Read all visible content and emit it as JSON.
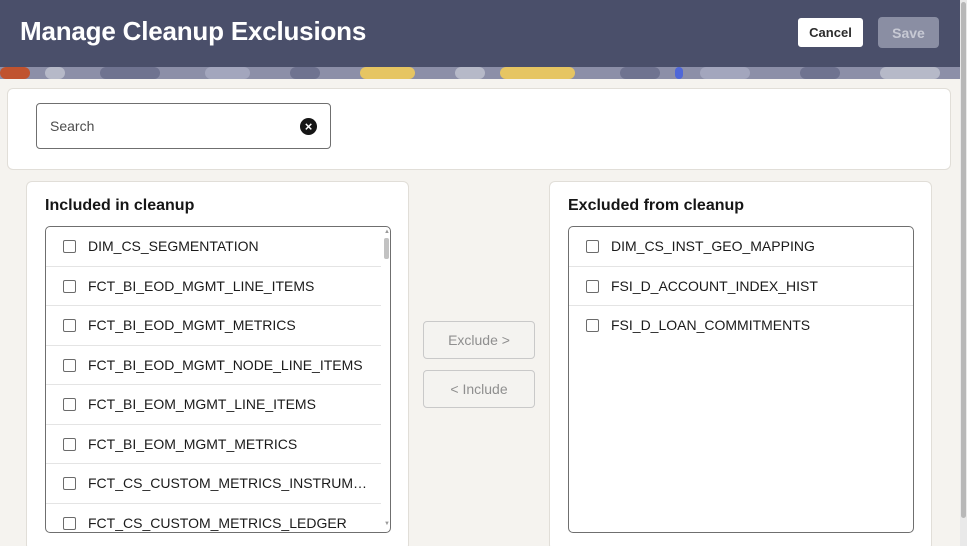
{
  "header": {
    "title": "Manage Cleanup Exclusions",
    "cancel_label": "Cancel",
    "save_label": "Save",
    "background": "#4a4f6a"
  },
  "search": {
    "placeholder": "Search",
    "value": "",
    "clear_icon": "clear-circle-icon"
  },
  "included": {
    "heading": "Included in cleanup",
    "items": [
      {
        "label": "DIM_CS_SEGMENTATION",
        "checked": false
      },
      {
        "label": "FCT_BI_EOD_MGMT_LINE_ITEMS",
        "checked": false
      },
      {
        "label": "FCT_BI_EOD_MGMT_METRICS",
        "checked": false
      },
      {
        "label": "FCT_BI_EOD_MGMT_NODE_LINE_ITEMS",
        "checked": false
      },
      {
        "label": "FCT_BI_EOM_MGMT_LINE_ITEMS",
        "checked": false
      },
      {
        "label": "FCT_BI_EOM_MGMT_METRICS",
        "checked": false
      },
      {
        "label": "FCT_CS_CUSTOM_METRICS_INSTRUM…",
        "checked": false
      },
      {
        "label": "FCT_CS_CUSTOM_METRICS_LEDGER",
        "checked": false
      }
    ]
  },
  "actions": {
    "exclude_label": "Exclude >",
    "include_label": "< Include"
  },
  "excluded": {
    "heading": "Excluded from cleanup",
    "items": [
      {
        "label": "DIM_CS_INST_GEO_MAPPING",
        "checked": false
      },
      {
        "label": "FSI_D_ACCOUNT_INDEX_HIST",
        "checked": false
      },
      {
        "label": "FSI_D_LOAN_COMMITMENTS",
        "checked": false
      }
    ]
  }
}
